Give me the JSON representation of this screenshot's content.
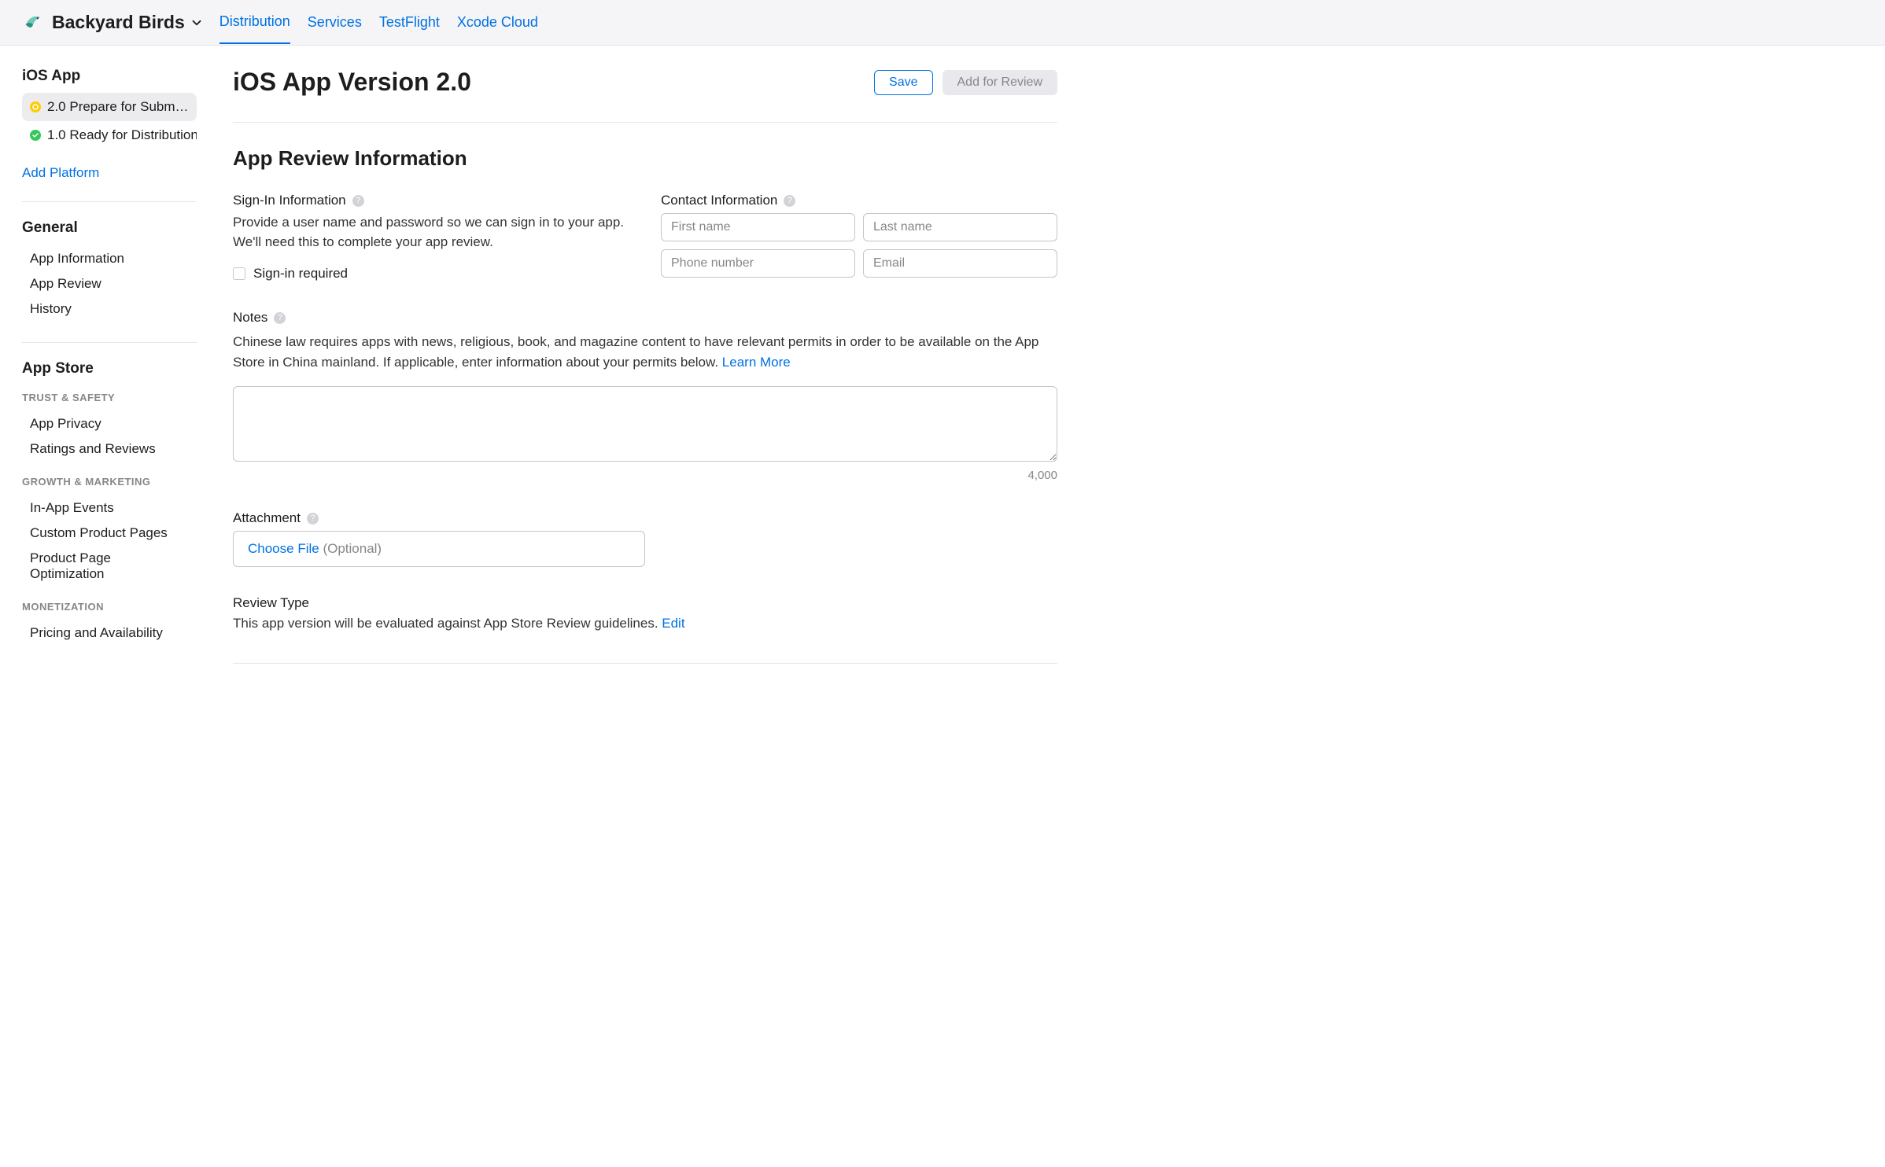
{
  "header": {
    "app_name": "Backyard Birds",
    "tabs": [
      "Distribution",
      "Services",
      "TestFlight",
      "Xcode Cloud"
    ],
    "active_tab": 0
  },
  "sidebar": {
    "platform_heading": "iOS App",
    "versions": [
      {
        "label": "2.0 Prepare for Submissi…",
        "status": "yellow",
        "selected": true
      },
      {
        "label": "1.0 Ready for Distribution",
        "status": "green",
        "selected": false
      }
    ],
    "add_platform": "Add Platform",
    "general": {
      "title": "General",
      "items": [
        "App Information",
        "App Review",
        "History"
      ]
    },
    "appstore": {
      "title": "App Store",
      "groups": [
        {
          "subtitle": "TRUST & SAFETY",
          "items": [
            "App Privacy",
            "Ratings and Reviews"
          ]
        },
        {
          "subtitle": "GROWTH & MARKETING",
          "items": [
            "In-App Events",
            "Custom Product Pages",
            "Product Page Optimization"
          ]
        },
        {
          "subtitle": "MONETIZATION",
          "items": [
            "Pricing and Availability"
          ]
        }
      ]
    }
  },
  "page": {
    "title": "iOS App Version 2.0",
    "save": "Save",
    "add_for_review": "Add for Review",
    "section": "App Review Information",
    "signin": {
      "label": "Sign-In Information",
      "desc": "Provide a user name and password so we can sign in to your app. We'll need this to complete your app review.",
      "checkbox_label": "Sign-in required"
    },
    "contact": {
      "label": "Contact Information",
      "first_name_ph": "First name",
      "last_name_ph": "Last name",
      "phone_ph": "Phone number",
      "email_ph": "Email"
    },
    "notes": {
      "label": "Notes",
      "desc": "Chinese law requires apps with news, religious, book, and magazine content to have relevant permits in order to be available on the App Store in China mainland. If applicable, enter information about your permits below. ",
      "learn_more": "Learn More",
      "char_count": "4,000"
    },
    "attachment": {
      "label": "Attachment",
      "choose_file": "Choose File",
      "optional": "(Optional)"
    },
    "review_type": {
      "label": "Review Type",
      "text": "This app version will be evaluated against App Store Review guidelines. ",
      "edit": "Edit"
    }
  }
}
